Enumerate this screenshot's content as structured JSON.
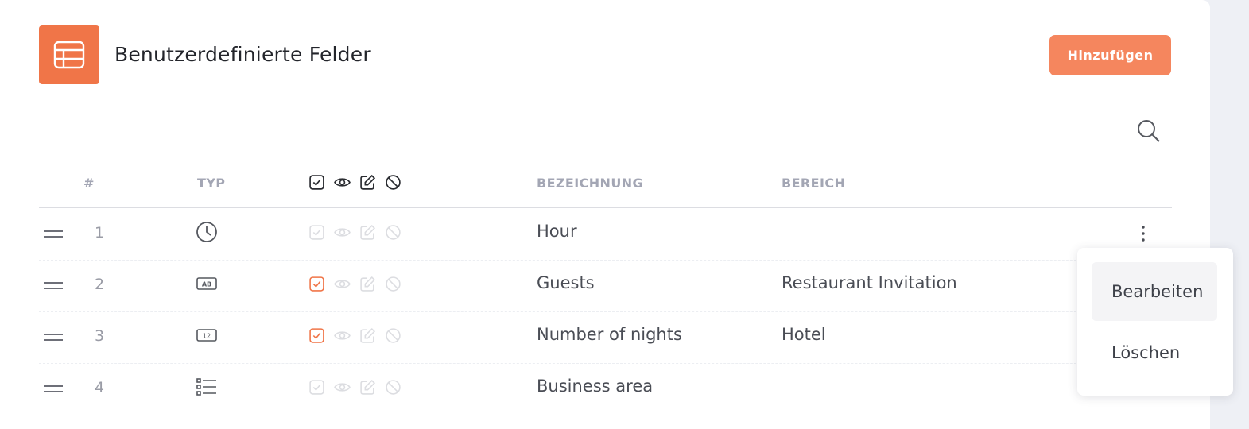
{
  "header": {
    "title": "Benutzerdefinierte Felder",
    "add_label": "Hinzufügen",
    "icon": "table-icon"
  },
  "table": {
    "columns": {
      "number": "#",
      "type": "TYP",
      "flags_icons": [
        "checkbox-icon",
        "eye-icon",
        "edit-icon",
        "block-icon"
      ],
      "label": "BEZEICHNUNG",
      "area": "BEREICH"
    },
    "rows": [
      {
        "number": "1",
        "type_icon": "clock-icon",
        "required": false,
        "label": "Hour",
        "area": ""
      },
      {
        "number": "2",
        "type_icon": "text-ab-icon",
        "required": true,
        "label": "Guests",
        "area": "Restaurant Invitation"
      },
      {
        "number": "3",
        "type_icon": "number-12-icon",
        "required": true,
        "label": "Number of nights",
        "area": "Hotel"
      },
      {
        "number": "4",
        "type_icon": "list-icon",
        "required": false,
        "label": "Business area",
        "area": ""
      }
    ]
  },
  "context_menu": {
    "edit_label": "Bearbeiten",
    "delete_label": "Löschen"
  },
  "colors": {
    "accent": "#f07548",
    "button": "#f5865e",
    "header_text": "#a3a6b4"
  }
}
